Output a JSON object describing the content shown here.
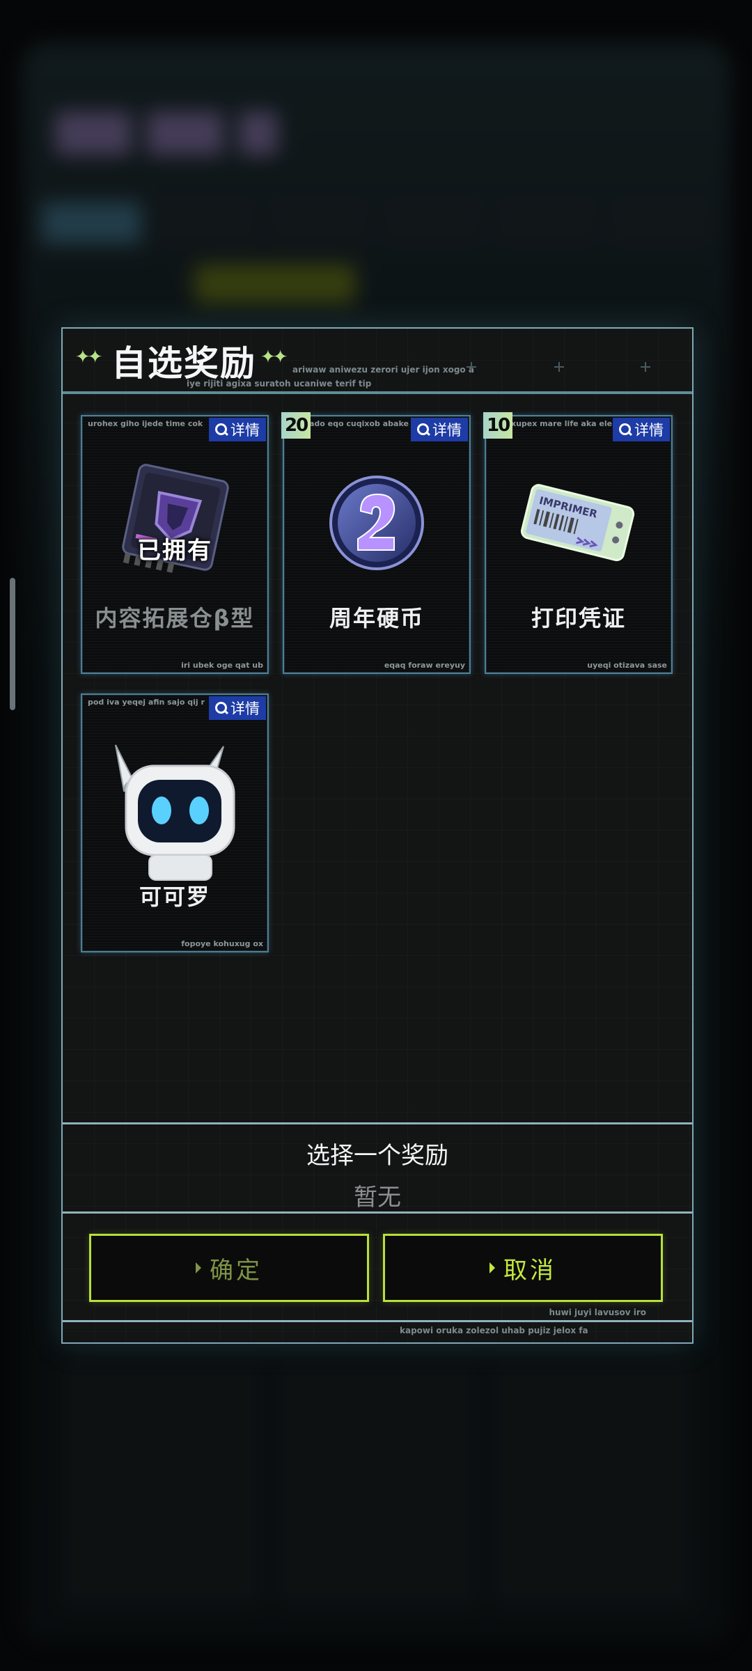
{
  "dialog": {
    "title": "自选奖励",
    "sparkle_left": "✦✦",
    "sparkle_right": "✦✦",
    "header_note_1": "ariwaw aniwezu zerori ujer ijon xogo a",
    "header_note_2": "iye rijiti agixa suratoh ucaniwe terif tip",
    "detail_label": "详情",
    "select_prompt": "选择一个奖励",
    "selected_value": "暂无",
    "confirm_label": "确定",
    "cancel_label": "取消",
    "button_note": "huwi juyi lavusov iro",
    "bottom_note": "kapowi oruka zolezol uhab pujiz jelox fa"
  },
  "rewards": [
    {
      "name": "内容拓展仓β型",
      "owned_label": "已拥有",
      "quantity": "",
      "top_text": "urohex giho ijede time cok",
      "bottom_text": "iri ubek oge qat ub",
      "icon": "expansion-chip-icon"
    },
    {
      "name": "周年硬币",
      "owned_label": "",
      "quantity": "20",
      "top_text": "ado eqo cuqixob abake",
      "bottom_text": "eqaq foraw ereyuy",
      "icon": "anniversary-coin-icon"
    },
    {
      "name": "打印凭证",
      "owned_label": "",
      "quantity": "10",
      "top_text": "xupex mare life aka ele",
      "bottom_text": "uyeqi otizava sase",
      "icon": "print-ticket-icon",
      "ticket_text": "IMPRIMER"
    },
    {
      "name": "可可罗",
      "owned_label": "",
      "quantity": "",
      "top_text": "pod iva yeqej afin sajo qij r",
      "bottom_text": "fopoye kohuxug ox",
      "icon": "robot-mascot-icon"
    }
  ],
  "colors": {
    "accent": "#c4e83e",
    "frame": "#7fa8b5",
    "detail_button": "#1e3ca6",
    "qty_badge": "#b8e0b0"
  }
}
